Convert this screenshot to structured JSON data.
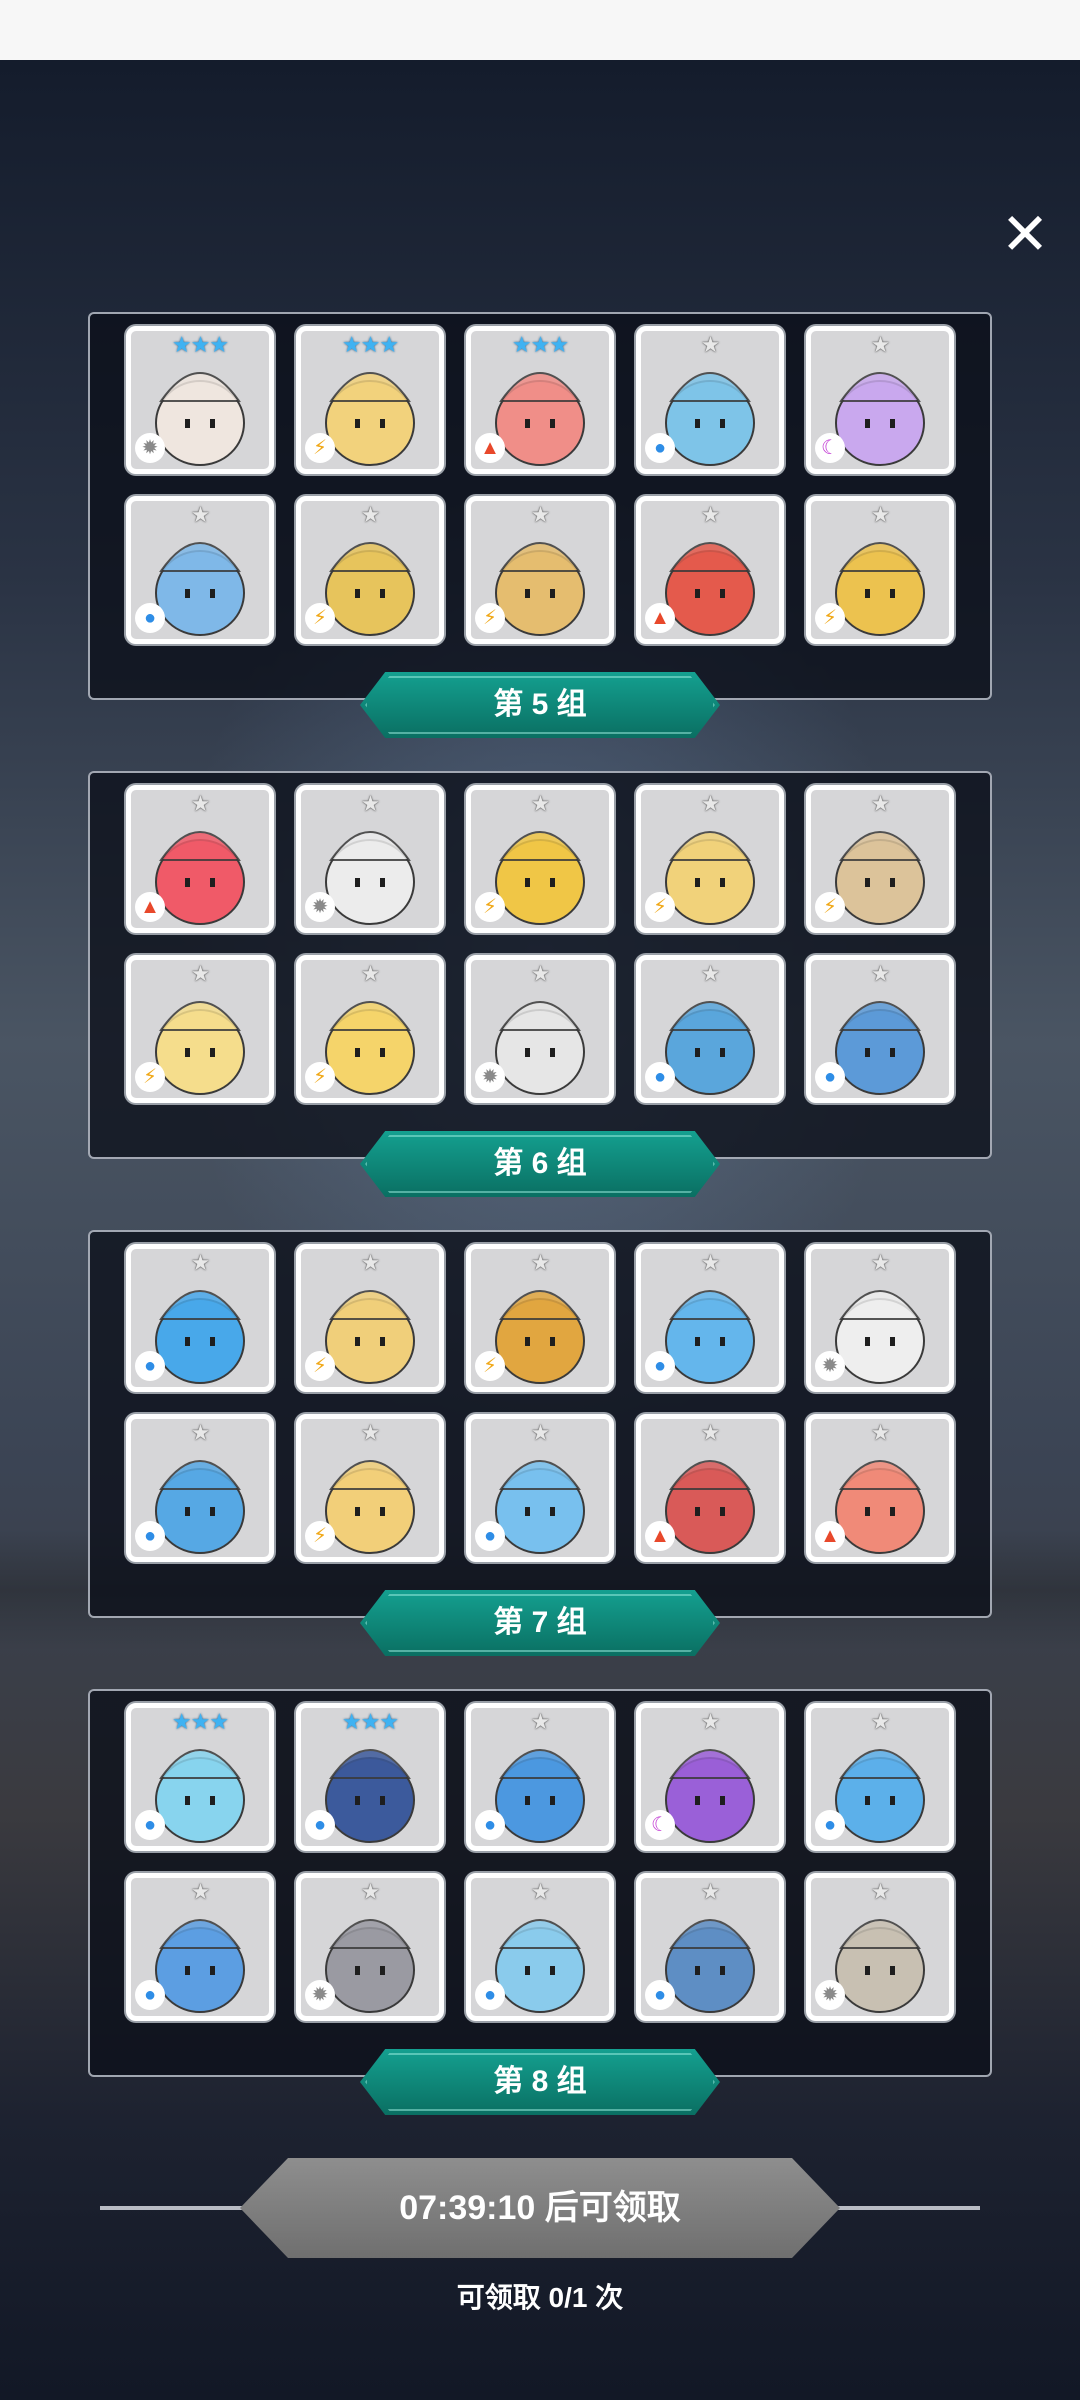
{
  "close_icon_char": "✕",
  "groups": [
    {
      "label": "第 5 组",
      "heroes": [
        {
          "stars": "★★★",
          "rarity": "three",
          "element": "light",
          "color": "#efe6df"
        },
        {
          "stars": "★★★",
          "rarity": "three",
          "element": "thunder",
          "color": "#f2d27c"
        },
        {
          "stars": "★★★",
          "rarity": "three",
          "element": "fire",
          "color": "#f08e88"
        },
        {
          "stars": "★",
          "rarity": "one",
          "element": "water",
          "color": "#7ec4e8"
        },
        {
          "stars": "★",
          "rarity": "one",
          "element": "dark",
          "color": "#c9a8ee"
        },
        {
          "stars": "★",
          "rarity": "one",
          "element": "water",
          "color": "#7fb8e8"
        },
        {
          "stars": "★",
          "rarity": "one",
          "element": "thunder",
          "color": "#e7c45c"
        },
        {
          "stars": "★",
          "rarity": "one",
          "element": "thunder",
          "color": "#e5bd6f"
        },
        {
          "stars": "★",
          "rarity": "one",
          "element": "fire",
          "color": "#e45a4c"
        },
        {
          "stars": "★",
          "rarity": "one",
          "element": "thunder",
          "color": "#ecc24f"
        }
      ]
    },
    {
      "label": "第 6 组",
      "heroes": [
        {
          "stars": "★",
          "rarity": "one",
          "element": "fire",
          "color": "#f05a68"
        },
        {
          "stars": "★",
          "rarity": "one",
          "element": "light",
          "color": "#ececec"
        },
        {
          "stars": "★",
          "rarity": "one",
          "element": "thunder",
          "color": "#f0c646"
        },
        {
          "stars": "★",
          "rarity": "one",
          "element": "thunder",
          "color": "#f1d27a"
        },
        {
          "stars": "★",
          "rarity": "one",
          "element": "thunder",
          "color": "#dcc39a"
        },
        {
          "stars": "★",
          "rarity": "one",
          "element": "thunder",
          "color": "#f5dd8c"
        },
        {
          "stars": "★",
          "rarity": "one",
          "element": "thunder",
          "color": "#f5d46a"
        },
        {
          "stars": "★",
          "rarity": "one",
          "element": "light",
          "color": "#e6e6e6"
        },
        {
          "stars": "★",
          "rarity": "one",
          "element": "water",
          "color": "#5aa6dc"
        },
        {
          "stars": "★",
          "rarity": "one",
          "element": "water",
          "color": "#5c9ad8"
        }
      ]
    },
    {
      "label": "第 7 组",
      "heroes": [
        {
          "stars": "★",
          "rarity": "one",
          "element": "water",
          "color": "#48a8ea"
        },
        {
          "stars": "★",
          "rarity": "one",
          "element": "thunder",
          "color": "#f0cf7a"
        },
        {
          "stars": "★",
          "rarity": "one",
          "element": "thunder",
          "color": "#e1a640"
        },
        {
          "stars": "★",
          "rarity": "one",
          "element": "water",
          "color": "#64b6ec"
        },
        {
          "stars": "★",
          "rarity": "one",
          "element": "light",
          "color": "#eeeeee"
        },
        {
          "stars": "★",
          "rarity": "one",
          "element": "water",
          "color": "#56a8e4"
        },
        {
          "stars": "★",
          "rarity": "one",
          "element": "thunder",
          "color": "#f2cf79"
        },
        {
          "stars": "★",
          "rarity": "one",
          "element": "water",
          "color": "#78c0ee"
        },
        {
          "stars": "★",
          "rarity": "one",
          "element": "fire",
          "color": "#d95a58"
        },
        {
          "stars": "★",
          "rarity": "one",
          "element": "fire",
          "color": "#f08a78"
        }
      ]
    },
    {
      "label": "第 8 组",
      "heroes": [
        {
          "stars": "★★★",
          "rarity": "three",
          "element": "water",
          "color": "#88d4ee"
        },
        {
          "stars": "★★★",
          "rarity": "three",
          "element": "water",
          "color": "#3c5a9c"
        },
        {
          "stars": "★",
          "rarity": "one",
          "element": "water",
          "color": "#4c98e0"
        },
        {
          "stars": "★",
          "rarity": "one",
          "element": "dark",
          "color": "#9a60d8"
        },
        {
          "stars": "★",
          "rarity": "one",
          "element": "water",
          "color": "#5cb0ea"
        },
        {
          "stars": "★",
          "rarity": "one",
          "element": "water",
          "color": "#5c9ee2"
        },
        {
          "stars": "★",
          "rarity": "one",
          "element": "light",
          "color": "#9a9aa2"
        },
        {
          "stars": "★",
          "rarity": "one",
          "element": "water",
          "color": "#8acbec"
        },
        {
          "stars": "★",
          "rarity": "one",
          "element": "water",
          "color": "#5e8ec4"
        },
        {
          "stars": "★",
          "rarity": "one",
          "element": "light",
          "color": "#c8c0b2"
        }
      ]
    }
  ],
  "element_glyphs": {
    "water": "💧",
    "fire": "🔥",
    "thunder": "⚡",
    "light": "✺",
    "dark": "☾"
  },
  "claim": {
    "button_label": "07:39:10 后可领取",
    "count_label": "可领取 0/1 次"
  }
}
